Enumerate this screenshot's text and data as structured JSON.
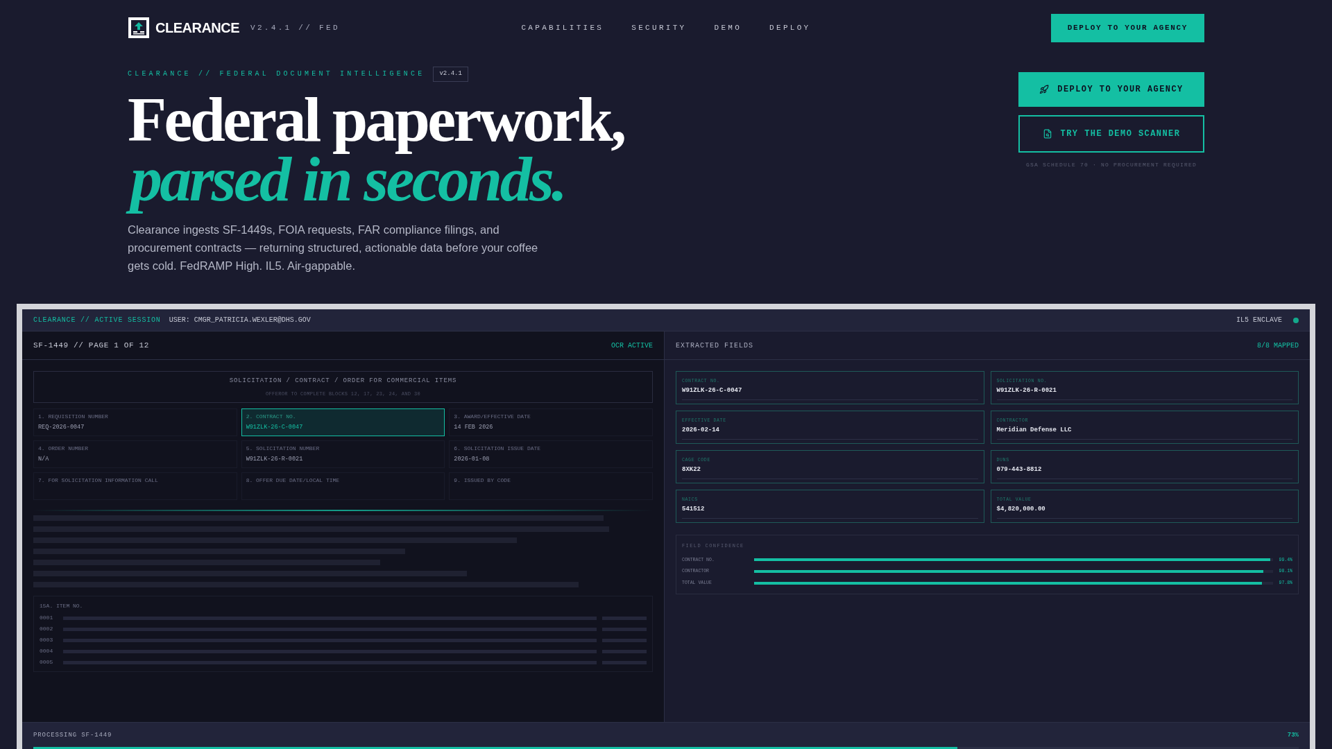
{
  "nav": {
    "brand": "CLEARANCE",
    "version": "V2.4.1 // FED",
    "links": [
      "CAPABILITIES",
      "SECURITY",
      "DEMO",
      "DEPLOY"
    ],
    "cta": "DEPLOY TO YOUR AGENCY"
  },
  "hero": {
    "eyebrow": "CLEARANCE // FEDERAL DOCUMENT INTELLIGENCE",
    "badge": "v2.4.1",
    "headline": "Federal paperwork,",
    "headline_accent": "parsed in seconds.",
    "body": "Clearance ingests SF-1449s, FOIA requests, FAR compliance filings, and procurement contracts — returning structured, actionable data before your coffee gets cold. FedRAMP High. IL5. Air-gappable.",
    "primary_button": "DEPLOY TO YOUR AGENCY",
    "secondary_button": "TRY THE DEMO SCANNER",
    "note": "GSA SCHEDULE 70 · NO PROCUREMENT REQUIRED"
  },
  "session": {
    "title": "CLEARANCE // ACTIVE SESSION",
    "user": "USER: CMGR_PATRICIA.WEXLER@DHS.GOV",
    "enclave": "IL5 ENCLAVE"
  },
  "document": {
    "title": "SF-1449 // PAGE 1 OF 12",
    "status": "OCR ACTIVE",
    "form_title": "SOLICITATION / CONTRACT / ORDER FOR COMMERCIAL ITEMS",
    "form_subtitle": "OFFEROR TO COMPLETE BLOCKS 12, 17, 23, 24, AND 30",
    "blocks": [
      {
        "label": "1. REQUISITION NUMBER",
        "value": "REQ-2026-0047",
        "selected": false
      },
      {
        "label": "2. CONTRACT NO.",
        "value": "W91ZLK-26-C-0047",
        "selected": true
      },
      {
        "label": "3. AWARD/EFFECTIVE DATE",
        "value": "14 FEB 2026",
        "selected": false
      },
      {
        "label": "4. ORDER NUMBER",
        "value": "N/A",
        "selected": false
      },
      {
        "label": "5. SOLICITATION NUMBER",
        "value": "W91ZLK-26-R-0021",
        "selected": false
      },
      {
        "label": "6. SOLICITATION ISSUE DATE",
        "value": "2026-01-08",
        "selected": false
      },
      {
        "label": "7. FOR SOLICITATION INFORMATION CALL",
        "selected": false
      },
      {
        "label": "8. OFFER DUE DATE/LOCAL TIME",
        "selected": false
      },
      {
        "label": "9. ISSUED BY CODE",
        "selected": false
      }
    ],
    "items_heading": "15A. ITEM NO.",
    "items": [
      "0001",
      "0002",
      "0003",
      "0004",
      "0005"
    ]
  },
  "extracted": {
    "title": "EXTRACTED FIELDS",
    "status": "8/8 MAPPED",
    "fields": [
      {
        "label": "CONTRACT NO.",
        "value": "W91ZLK-26-C-0047"
      },
      {
        "label": "SOLICITATION NO.",
        "value": "W91ZLK-26-R-0021"
      },
      {
        "label": "EFFECTIVE DATE",
        "value": "2026-02-14"
      },
      {
        "label": "CONTRACTOR",
        "value": "Meridian Defense LLC"
      },
      {
        "label": "CAGE CODE",
        "value": "8XK22"
      },
      {
        "label": "DUNS",
        "value": "079-443-8812"
      },
      {
        "label": "NAICS",
        "value": "541512"
      },
      {
        "label": "TOTAL VALUE",
        "value": "$4,820,000.00"
      }
    ],
    "confidence_title": "FIELD CONFIDENCE",
    "confidence": [
      {
        "label": "CONTRACT NO.",
        "level": 0.994,
        "reading": "99.4%"
      },
      {
        "label": "CONTRACTOR",
        "level": 0.981,
        "reading": "98.1%"
      },
      {
        "label": "TOTAL VALUE",
        "level": 0.978,
        "reading": "97.8%"
      }
    ]
  },
  "processing": {
    "label": "PROCESSING SF-1449",
    "reading": "73%",
    "level": 0.73
  }
}
